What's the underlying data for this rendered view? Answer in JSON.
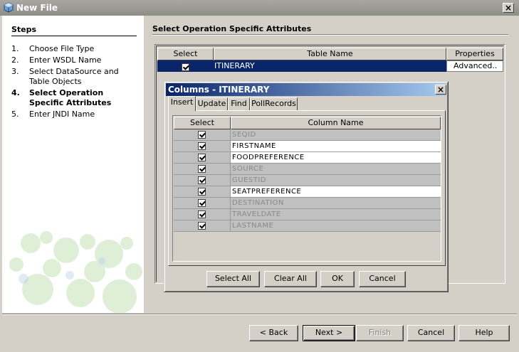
{
  "window": {
    "title": "New File"
  },
  "steps": {
    "heading": "Steps",
    "items": [
      {
        "num": "1.",
        "label": "Choose File Type"
      },
      {
        "num": "2.",
        "label": "Enter WSDL Name"
      },
      {
        "num": "3.",
        "label": "Select DataSource and Table Objects"
      },
      {
        "num": "4.",
        "label": "Select Operation Specific Attributes"
      },
      {
        "num": "5.",
        "label": "Enter JNDI Name"
      }
    ],
    "current": 4
  },
  "main": {
    "title": "Select Operation Specific Attributes",
    "table": {
      "headers": [
        "Select",
        "Table Name",
        "Properties"
      ],
      "rows": [
        {
          "selected": true,
          "table_name": "ITINERARY",
          "properties": "Advanced.."
        }
      ]
    }
  },
  "dialog": {
    "title": "Columns - ITINERARY",
    "tabs": [
      "Insert",
      "Update",
      "Find",
      "PollRecords"
    ],
    "active_tab": "Insert",
    "grid_headers": [
      "Select",
      "Column Name"
    ],
    "columns": [
      {
        "name": "SEQID",
        "checked": true,
        "enabled": false
      },
      {
        "name": "FIRSTNAME",
        "checked": true,
        "enabled": true
      },
      {
        "name": "FOODPREFERENCE",
        "checked": true,
        "enabled": true
      },
      {
        "name": "SOURCE",
        "checked": true,
        "enabled": false
      },
      {
        "name": "GUESTID",
        "checked": true,
        "enabled": false
      },
      {
        "name": "SEATPREFERENCE",
        "checked": true,
        "enabled": true
      },
      {
        "name": "DESTINATION",
        "checked": true,
        "enabled": false
      },
      {
        "name": "TRAVELDATE",
        "checked": true,
        "enabled": false
      },
      {
        "name": "LASTNAME",
        "checked": true,
        "enabled": false
      }
    ],
    "buttons": {
      "select_all": "Select All",
      "clear_all": "Clear All",
      "ok": "OK",
      "cancel": "Cancel"
    }
  },
  "footer": {
    "back": "< Back",
    "next": "Next >",
    "finish": "Finish",
    "cancel": "Cancel",
    "help": "Help"
  },
  "colors": {
    "selection": "#0a246a",
    "face": "#d4d0c8",
    "disabled_text": "#8a8a8a"
  }
}
